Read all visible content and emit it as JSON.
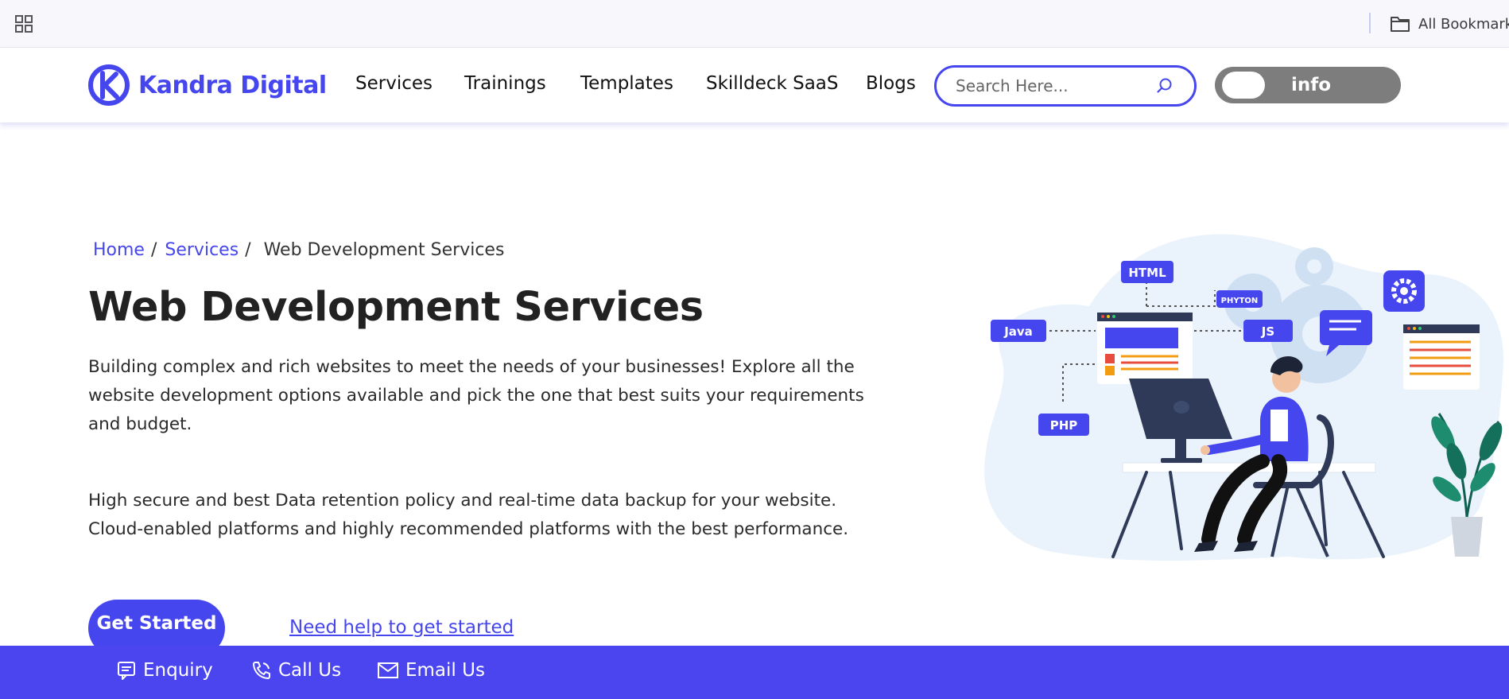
{
  "browser": {
    "apps_icon": "grid-icon",
    "all_bookmarks_label": "All Bookmarks",
    "folder_icon": "folder-icon"
  },
  "header": {
    "logo_text": "Kandra Digital",
    "nav": [
      {
        "label": "Services"
      },
      {
        "label": "Trainings"
      },
      {
        "label": "Templates"
      },
      {
        "label": "Skilldeck SaaS"
      },
      {
        "label": "Blogs"
      }
    ],
    "search_placeholder": "Search Here...",
    "search_icon": "search-icon",
    "toggle_label": "info"
  },
  "breadcrumb": {
    "items": [
      {
        "label": "Home"
      },
      {
        "label": "Services"
      }
    ],
    "separator": "/",
    "current": "Web Development Services"
  },
  "main": {
    "title": "Web Development Services",
    "paragraph_1": "Building complex and rich websites to meet the needs of your businesses! Explore all the website development options available and pick the one that best suits your requirements and budget.",
    "paragraph_2": "High secure and best Data retention policy and real-time data backup for your website. Cloud-enabled platforms and highly recommended platforms with the best performance.",
    "cta_label": "Get Started",
    "help_link_label": "Need help to get started"
  },
  "illustration": {
    "tags": {
      "html": "HTML",
      "java": "Java",
      "js": "JS",
      "php": "PHP",
      "python": "PHYTON"
    }
  },
  "contact_bar": {
    "items": [
      {
        "label": "Enquiry",
        "icon": "chat-icon"
      },
      {
        "label": "Call Us",
        "icon": "phone-icon"
      },
      {
        "label": "Email Us",
        "icon": "mail-icon"
      }
    ]
  },
  "colors": {
    "brand": "#4646ee",
    "bar": "#4b45ef",
    "toggle": "#7d7d7d"
  }
}
